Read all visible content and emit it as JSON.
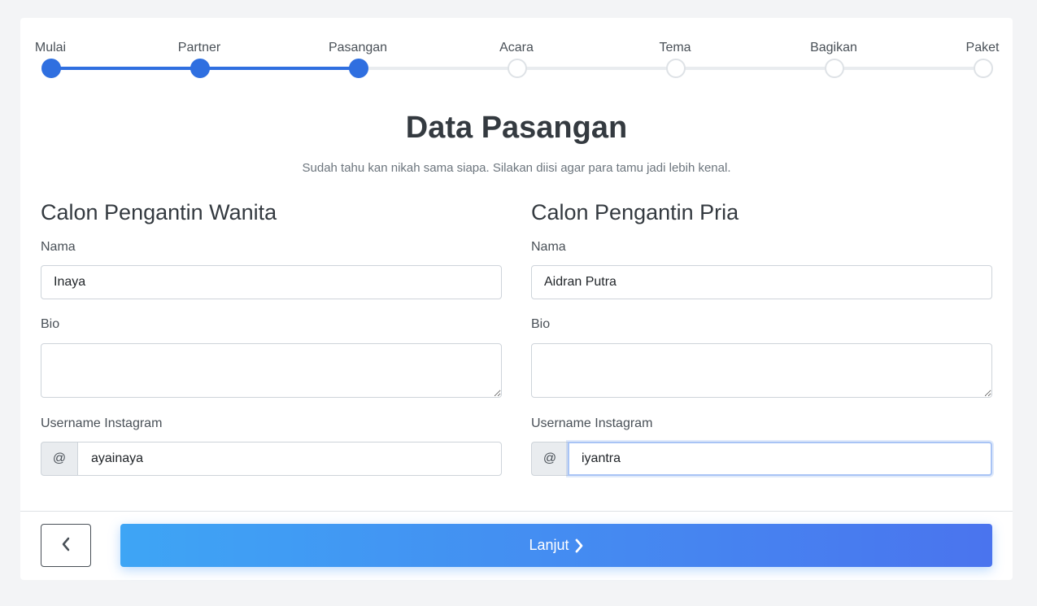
{
  "stepper": {
    "current_index": 2,
    "steps": [
      {
        "label": "Mulai",
        "done": true
      },
      {
        "label": "Partner",
        "done": true
      },
      {
        "label": "Pasangan",
        "done": true
      },
      {
        "label": "Acara",
        "done": false
      },
      {
        "label": "Tema",
        "done": false
      },
      {
        "label": "Bagikan",
        "done": false
      },
      {
        "label": "Paket",
        "done": false
      }
    ],
    "accent_color": "#2f6fe0"
  },
  "header": {
    "title": "Data Pasangan",
    "subtitle": "Sudah tahu kan nikah sama siapa. Silakan diisi agar para tamu jadi lebih kenal."
  },
  "bride": {
    "section_title": "Calon Pengantin Wanita",
    "name_label": "Nama",
    "name_value": "Inaya",
    "bio_label": "Bio",
    "bio_value": "",
    "instagram_label": "Username Instagram",
    "instagram_prefix": "@",
    "instagram_value": "ayainaya"
  },
  "groom": {
    "section_title": "Calon Pengantin Pria",
    "name_label": "Nama",
    "name_value": "Aidran Putra",
    "bio_label": "Bio",
    "bio_value": "",
    "instagram_label": "Username Instagram",
    "instagram_prefix": "@",
    "instagram_value": "iyantra"
  },
  "footer": {
    "back_icon": "chevron-left-icon",
    "next_label": "Lanjut",
    "next_icon": "chevron-right-icon"
  }
}
